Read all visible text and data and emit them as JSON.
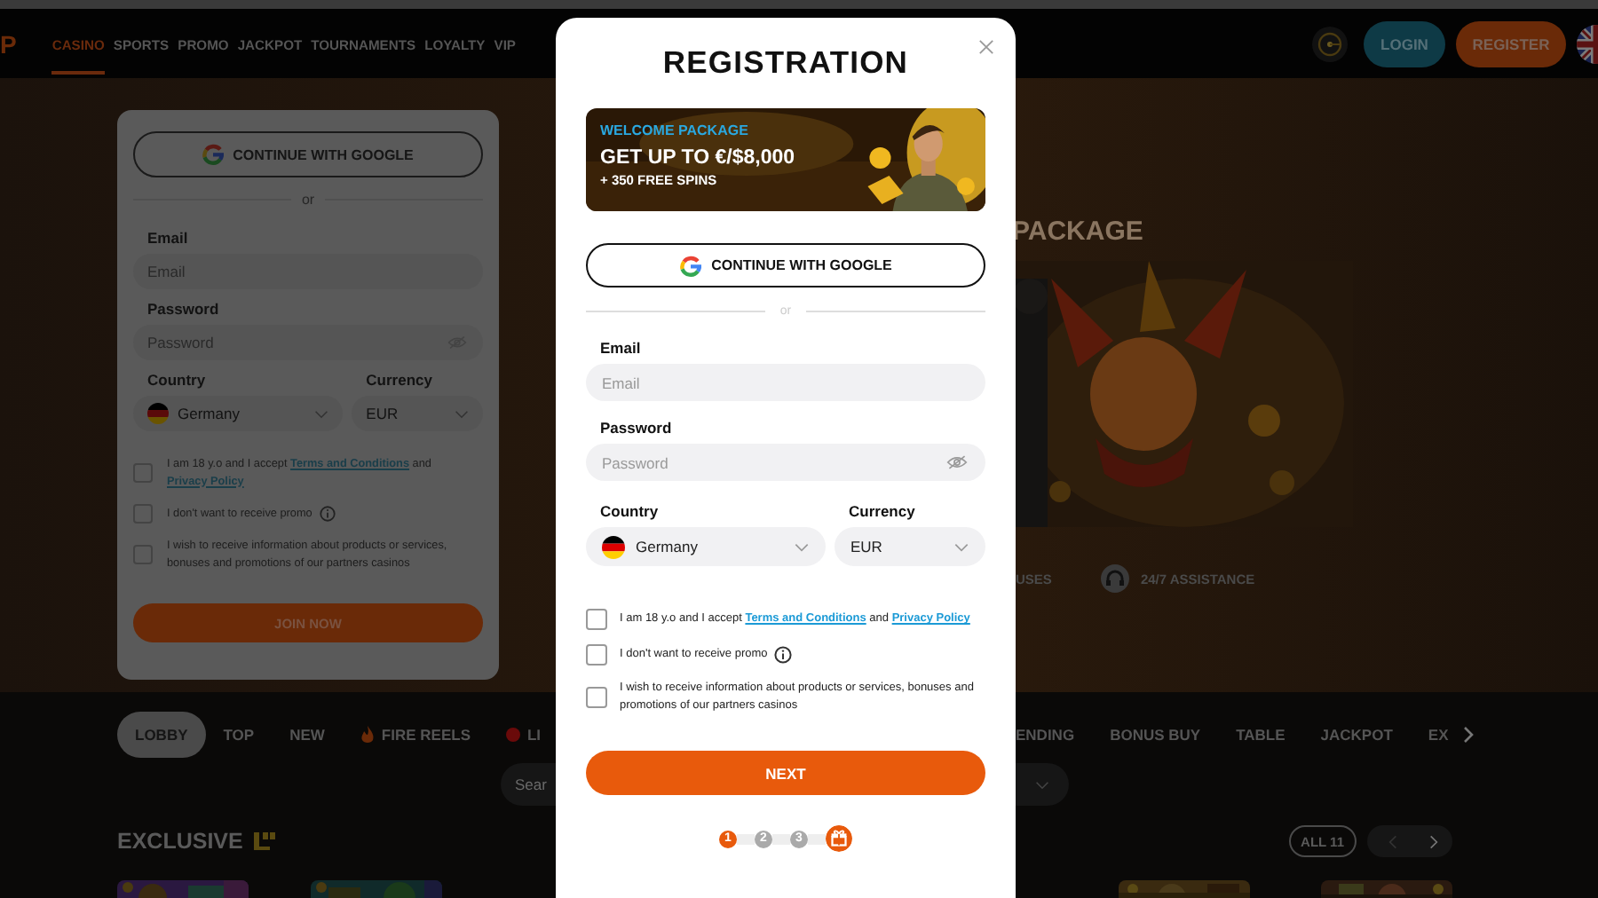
{
  "header": {
    "logo": "P",
    "nav": [
      {
        "label": "CASINO",
        "selected": true
      },
      {
        "label": "SPORTS",
        "selected": false
      },
      {
        "label": "PROMO",
        "selected": false
      },
      {
        "label": "JACKPOT",
        "selected": false
      },
      {
        "label": "TOURNAMENTS",
        "selected": false
      },
      {
        "label": "LOYALTY",
        "selected": false
      },
      {
        "label": "VIP",
        "selected": false
      }
    ],
    "login": "LOGIN",
    "register": "REGISTER"
  },
  "hero": {
    "title": "PACKAGE",
    "features": [
      {
        "kind": "none",
        "label": "USES"
      },
      {
        "kind": "headset",
        "label": "24/7 ASSISTANCE"
      }
    ]
  },
  "background_form": {
    "google": "CONTINUE WITH GOOGLE",
    "divider": "or",
    "email_label": "Email",
    "email_placeholder": "Email",
    "password_label": "Password",
    "password_placeholder": "Password",
    "country_label": "Country",
    "currency_label": "Currency",
    "country": "Germany",
    "currency": "EUR",
    "consents": [
      {
        "checked": false,
        "info": false,
        "parts": [
          {
            "kind": "text",
            "text": "I am 18 y.o and I accept "
          },
          {
            "kind": "link",
            "text": "Terms and Conditions"
          },
          {
            "kind": "text",
            "text": " and "
          },
          {
            "kind": "link",
            "text": "Privacy Policy"
          }
        ]
      },
      {
        "checked": false,
        "info": true,
        "parts": [
          {
            "kind": "text",
            "text": "I don't want to receive promo"
          }
        ]
      },
      {
        "checked": false,
        "info": false,
        "parts": [
          {
            "kind": "text",
            "text": "I wish to receive information about products or services, bonuses and promotions of our partners casinos"
          }
        ]
      }
    ],
    "submit": "JOIN NOW"
  },
  "category_tabs": [
    {
      "label": "LOBBY",
      "kind": "plain",
      "selected": true
    },
    {
      "label": "TOP",
      "kind": "plain",
      "selected": false
    },
    {
      "label": "NEW",
      "kind": "plain",
      "selected": false
    },
    {
      "label": "FIRE REELS",
      "kind": "fire",
      "selected": false
    },
    {
      "label": "LI",
      "kind": "live",
      "selected": false
    }
  ],
  "category_tabs_after_dialog": [
    {
      "label": "ENDING",
      "selected": false
    },
    {
      "label": "BONUS BUY",
      "selected": false
    },
    {
      "label": "TABLE",
      "selected": false
    },
    {
      "label": "JACKPOT",
      "selected": false
    },
    {
      "label": "EX",
      "selected": false
    }
  ],
  "search": {
    "placeholder": "Sear"
  },
  "exclusive": {
    "title": "EXCLUSIVE",
    "all": "ALL 11"
  },
  "dialog": {
    "title": "REGISTRATION",
    "banner": {
      "tag": "WELCOME PACKAGE",
      "headline": "GET UP TO €/$8,000",
      "subline": "+ 350 FREE SPINS"
    },
    "google": "CONTINUE WITH GOOGLE",
    "divider": "or",
    "email_label": "Email",
    "email_placeholder": "Email",
    "password_label": "Password",
    "password_placeholder": "Password",
    "country_label": "Country",
    "currency_label": "Currency",
    "country": "Germany",
    "currency": "EUR",
    "consents": [
      {
        "checked": false,
        "info": false,
        "parts": [
          {
            "kind": "text",
            "text": "I am 18 y.o and I accept "
          },
          {
            "kind": "link",
            "text": "Terms and Conditions"
          },
          {
            "kind": "text",
            "text": " and "
          },
          {
            "kind": "link",
            "text": "Privacy Policy"
          }
        ]
      },
      {
        "checked": false,
        "info": true,
        "parts": [
          {
            "kind": "text",
            "text": "I don't want to receive promo"
          }
        ]
      },
      {
        "checked": false,
        "info": false,
        "parts": [
          {
            "kind": "text",
            "text": "I wish to receive information about products or services, bonuses and promotions of our partners casinos"
          }
        ]
      }
    ],
    "next": "NEXT",
    "steps": [
      {
        "kind": "number",
        "label": "1",
        "selected": true
      },
      {
        "kind": "number",
        "label": "2",
        "selected": false
      },
      {
        "kind": "number",
        "label": "3",
        "selected": false
      },
      {
        "kind": "gift",
        "selected": false
      }
    ]
  }
}
